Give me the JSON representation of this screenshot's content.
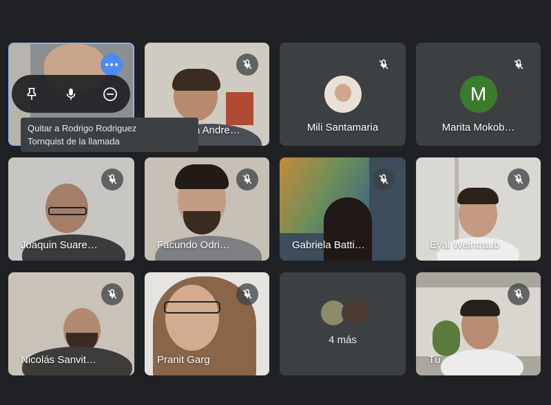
{
  "participants": [
    {
      "name": "Mili Santamaria",
      "has_video": false
    },
    {
      "name": "Marita Mokob…",
      "has_video": false,
      "initial": "M",
      "avatar_color": "#3a7b2d"
    },
    {
      "name": "Joaquin Suare…",
      "has_video": true
    },
    {
      "name": "Facundo Odri…",
      "has_video": true
    },
    {
      "name": "Gabriela Batti…",
      "has_video": true
    },
    {
      "name": "Eyal Weintraub",
      "has_video": true
    },
    {
      "name": "Nicolás Sanvit…",
      "has_video": true
    },
    {
      "name": "Pranit Garg",
      "has_video": true
    },
    {
      "name": "Tú",
      "has_video": true,
      "is_self": true
    }
  ],
  "partial_name": "a Andre…",
  "overflow": {
    "label": "4 más"
  },
  "tooltip": {
    "line1": "Quitar a Rodrigo Rodriguez",
    "line2": "Tornquist de la llamada"
  },
  "hover_controls": [
    "pin-icon",
    "microphone-icon",
    "remove-icon"
  ],
  "colors": {
    "background": "#202124",
    "tile": "#3c4043",
    "accent": "#4f8af0"
  }
}
